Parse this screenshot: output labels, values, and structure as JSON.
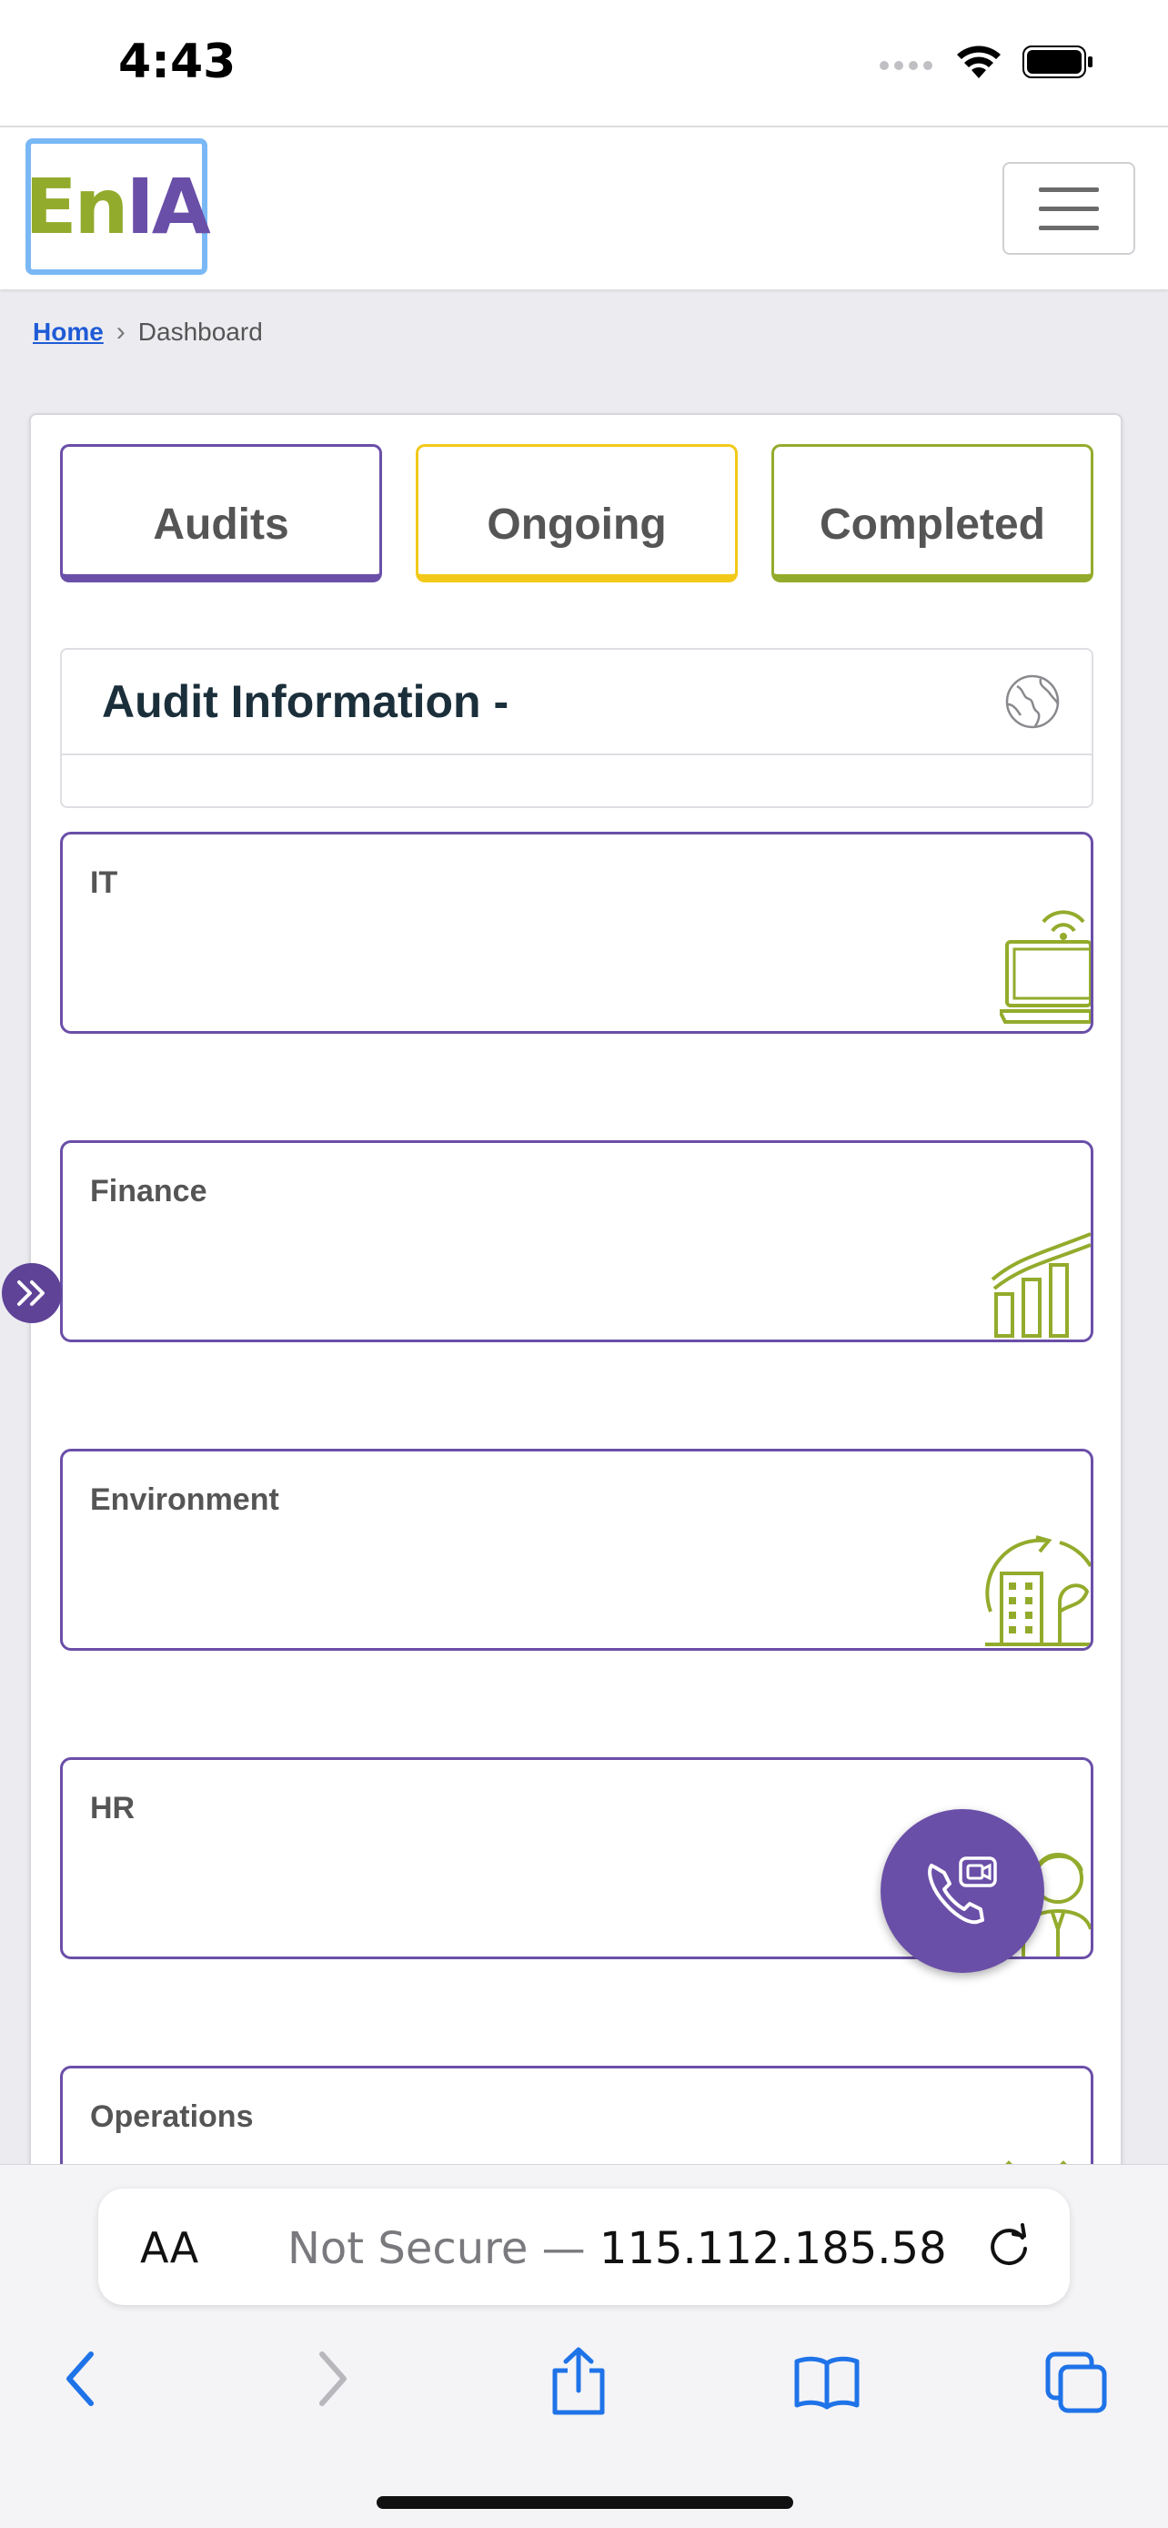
{
  "status_bar": {
    "time": "4:43"
  },
  "header": {
    "logo_part1": "En",
    "logo_part2": "IA"
  },
  "breadcrumb": {
    "home": "Home",
    "current": "Dashboard"
  },
  "tabs": [
    {
      "label": "Audits",
      "color": "#6a4fa8"
    },
    {
      "label": "Ongoing",
      "color": "#f2c919"
    },
    {
      "label": "Completed",
      "color": "#93ab2c"
    }
  ],
  "audit_info": {
    "title": "Audit Information -"
  },
  "departments": [
    {
      "label": "IT",
      "icon": "laptop-wifi-icon"
    },
    {
      "label": "Finance",
      "icon": "growth-chart-icon"
    },
    {
      "label": "Environment",
      "icon": "eco-building-icon"
    },
    {
      "label": "HR",
      "icon": "person-icon"
    },
    {
      "label": "Operations",
      "icon": "operations-icon"
    }
  ],
  "browser": {
    "text_size": "AA",
    "not_secure": "Not Secure —",
    "address": "115.112.185.58"
  },
  "colors": {
    "accent": "#6a4fa8",
    "green": "#93ab2c",
    "yellow": "#f2c919"
  }
}
